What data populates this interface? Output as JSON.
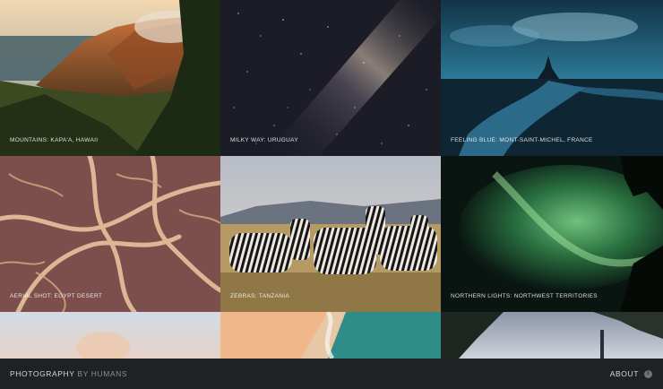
{
  "gallery": {
    "tiles": [
      {
        "caption": "MOUNTAINS: KAPA'A, HAWAII"
      },
      {
        "caption": "MILKY WAY: URUGUAY"
      },
      {
        "caption": "FEELING BLUE: MONT-SAINT-MICHEL, FRANCE"
      },
      {
        "caption": "AERIAL SHOT: EGYPT DESERT"
      },
      {
        "caption": "ZEBRAS: TANZANIA"
      },
      {
        "caption": "NORTHERN LIGHTS: NORTHWEST TERRITORIES"
      }
    ]
  },
  "footer": {
    "brand_main": "PHOTOGRAPHY",
    "brand_by": "BY HUMANS",
    "about_label": "ABOUT",
    "about_icon": "info-icon"
  },
  "colors": {
    "footer_bg": "#202123",
    "footer_text": "#d6d7d9",
    "footer_muted": "#8b8d91"
  }
}
